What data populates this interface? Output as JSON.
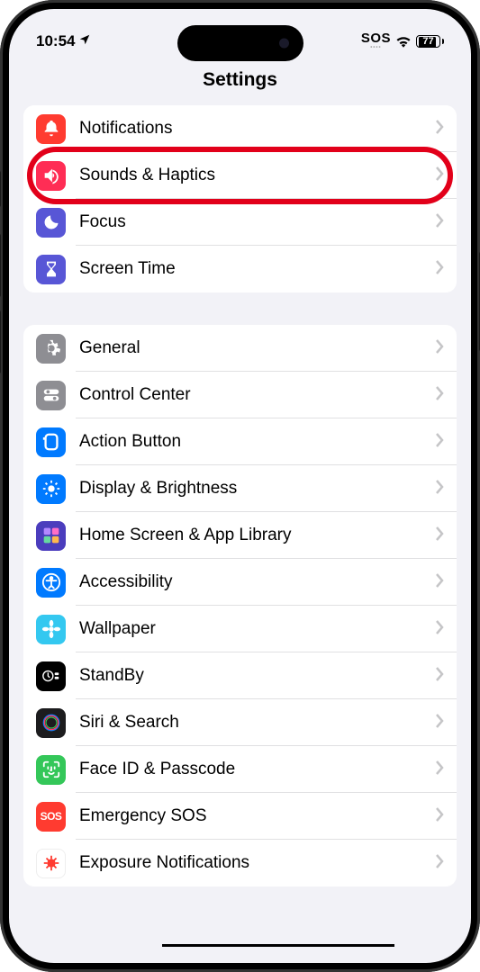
{
  "status": {
    "time": "10:54",
    "sos": "SOS",
    "battery": "77"
  },
  "header": {
    "title": "Settings"
  },
  "group1": {
    "items": [
      {
        "name": "notifications",
        "label": "Notifications",
        "icon": "bell",
        "bg": "#ff3b30"
      },
      {
        "name": "sounds",
        "label": "Sounds & Haptics",
        "icon": "speaker",
        "bg": "#ff2d55",
        "highlight": true
      },
      {
        "name": "focus",
        "label": "Focus",
        "icon": "moon",
        "bg": "#5856d6"
      },
      {
        "name": "screentime",
        "label": "Screen Time",
        "icon": "hourglass",
        "bg": "#5856d6"
      }
    ]
  },
  "group2": {
    "items": [
      {
        "name": "general",
        "label": "General",
        "icon": "gear",
        "bg": "#8e8e93"
      },
      {
        "name": "controlcenter",
        "label": "Control Center",
        "icon": "switches",
        "bg": "#8e8e93"
      },
      {
        "name": "actionbutton",
        "label": "Action Button",
        "icon": "action",
        "bg": "#007aff"
      },
      {
        "name": "display",
        "label": "Display & Brightness",
        "icon": "sun",
        "bg": "#007aff"
      },
      {
        "name": "homescreen",
        "label": "Home Screen & App Library",
        "icon": "grid",
        "bg": "#4b3dbd"
      },
      {
        "name": "accessibility",
        "label": "Accessibility",
        "icon": "person",
        "bg": "#007aff"
      },
      {
        "name": "wallpaper",
        "label": "Wallpaper",
        "icon": "flower",
        "bg": "#34c8f0"
      },
      {
        "name": "standby",
        "label": "StandBy",
        "icon": "clock",
        "bg": "#000000"
      },
      {
        "name": "siri",
        "label": "Siri & Search",
        "icon": "siri",
        "bg": "#1c1c1e"
      },
      {
        "name": "faceid",
        "label": "Face ID & Passcode",
        "icon": "faceid",
        "bg": "#34c759"
      },
      {
        "name": "emergency",
        "label": "Emergency SOS",
        "icon": "sos",
        "bg": "#ff3b30"
      },
      {
        "name": "exposure",
        "label": "Exposure Notifications",
        "icon": "virus",
        "bg": "#ffffff"
      }
    ]
  }
}
